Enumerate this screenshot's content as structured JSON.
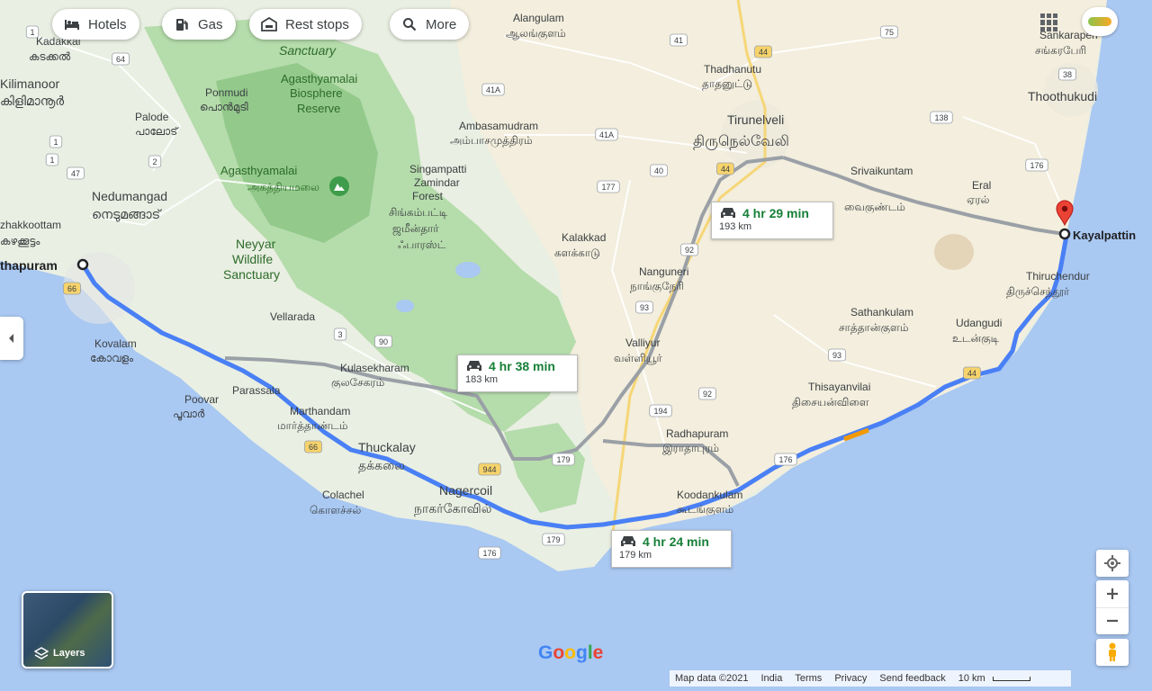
{
  "chips": [
    {
      "label": "Hotels",
      "icon": "bed-icon"
    },
    {
      "label": "Gas",
      "icon": "gas-pump-icon"
    },
    {
      "label": "Rest stops",
      "icon": "rest-stop-icon"
    },
    {
      "label": "More",
      "icon": "search-icon"
    }
  ],
  "routes": [
    {
      "time": "4 hr 24 min",
      "distance": "179 km",
      "selected": true
    },
    {
      "time": "4 hr 29 min",
      "distance": "193 km",
      "selected": false
    },
    {
      "time": "4 hr 38 min",
      "distance": "183 km",
      "selected": false
    }
  ],
  "places": {
    "origin": "thapuram",
    "destination": "Kayalpattin",
    "kadakkal": "Kadakkal",
    "kadakkal_ml": "കടക്കൽ",
    "kilimanoor": "Kilimanoor",
    "kilimanoor_ml": "കിളിമാനൂർ",
    "palode": "Palode",
    "palode_ml": "പാലോട്",
    "ponmudi": "Ponmudi",
    "ponmudi_ml": "പൊൻമുടി",
    "nedumangad": "Nedumangad",
    "nedumangad_ml": "നെടുമങ്ങാട്",
    "kazhakkoottam": "zhakkoottam",
    "kazhakkoottam_ml": "കഴക്കൂട്ടം",
    "sanctuary": "Sanctuary",
    "agasthyamalai_bio": "Agasthyamalai",
    "biosphere": "Biosphere",
    "reserve": "Reserve",
    "agasthyamalai": "Agasthyamalai",
    "agasthyamalai_ta": "அகத்தியமலை",
    "neyyar": "Neyyar",
    "wildlife": "Wildlife",
    "sanctuary2": "Sanctuary",
    "vellarada": "Vellarada",
    "kovalam": "Kovalam",
    "kovalam_ml": "കോവളം",
    "poovar": "Poovar",
    "poovar_ml": "പൂവാർ",
    "parassala": "Parassala",
    "marthandam": "Marthandam",
    "marthandam_ta": "மார்த்தாண்டம்",
    "thuckalay": "Thuckalay",
    "thuckalay_ta": "தக்கலை",
    "kulasekharam": "Kulasekharam",
    "kulasekharam_ta": "குலசேகரம்",
    "colachel": "Colachel",
    "colachel_ta": "கொளச்சல்",
    "nagercoil": "Nagercoil",
    "nagercoil_ta": "நாகர்கோவில்",
    "singampatti": "Singampatti",
    "zamindar": "Zamindar",
    "forest": "Forest",
    "singampatti_ta": "சிங்கம்பட்டி",
    "zamindar_ta": "ஜமீன்தார்",
    "forest_ta": "ஃபாரஸ்ட்",
    "alangulam": "Alangulam",
    "alangulam_ta": "ஆலங்குளம்",
    "ambasamudram": "Ambasamudram",
    "ambasamudram_ta": "அம்பாசமுத்திரம்",
    "thadhanutu": "Thadhanutu",
    "thadhanutu_ta": "தாதனுட்டு",
    "tirunelveli": "Tirunelveli",
    "tirunelveli_ta": "திருநெல்வேலி",
    "kalakkad": "Kalakkad",
    "kalakkad_ta": "களக்காடு",
    "nanguneri": "Nanguneri",
    "nanguneri_ta": "நாங்குநேரி",
    "valliyur": "Valliyur",
    "valliyur_ta": "வள்ளியூர்",
    "radhapuram": "Radhapuram",
    "radhapuram_ta": "இராதாபுரம்",
    "koodankulam": "Koodankulam",
    "koodankulam_ta": "கூடங்குளம்",
    "srivaikuntam": "Srivaikuntam",
    "srivaikuntam_ta": "வைகுண்டம்",
    "eral": "Eral",
    "eral_ta": "ஏரல்",
    "sankarapperi": "Sankaraperi",
    "sankarapperi_ta": "சங்கரபேரி",
    "thoothukudi": "Thoothukudi",
    "thiruchendur": "Thiruchendur",
    "thiruchendur_ta": "திருச்செந்தூர்",
    "sathankulam": "Sathankulam",
    "sathankulam_ta": "சாத்தான்குளம்",
    "udangudi": "Udangudi",
    "udangudi_ta": "உடன்குடி",
    "thisayanvilai": "Thisayanvilai",
    "thisayanvilai_ta": "திசையன்விளை"
  },
  "road_badges": [
    "1",
    "64",
    "1",
    "1",
    "2",
    "47",
    "66",
    "3",
    "90",
    "41A",
    "41",
    "44",
    "75",
    "38",
    "138",
    "176",
    "41A",
    "40",
    "177",
    "44",
    "92",
    "93",
    "93",
    "92",
    "194",
    "944",
    "179",
    "66",
    "179",
    "176",
    "176",
    "44"
  ],
  "layers_label": "Layers",
  "google_logo": "Google",
  "footer": {
    "map_data": "Map data ©2021",
    "region": "India",
    "terms": "Terms",
    "privacy": "Privacy",
    "feedback": "Send feedback",
    "scale": "10 km"
  },
  "colors": {
    "route_selected": "#4a80f5",
    "route_alt": "#9aa0a6",
    "water": "#a9c8f2",
    "land": "#f4f3ee",
    "forest": "#a8d7a4",
    "time_green": "#188038",
    "marker_red": "#ea4335"
  }
}
